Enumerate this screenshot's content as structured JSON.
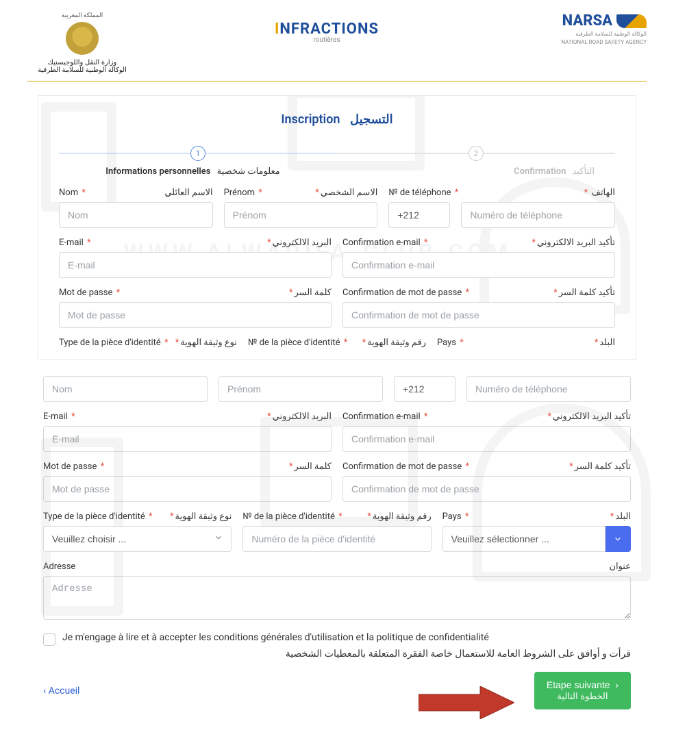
{
  "header": {
    "kingdom_ar": "المملكة المغربية",
    "ministry_ar": "وزارة النقل واللوجيستيك",
    "agency_ar": "الوكالة الوطنية للسلامة الطرقية",
    "center_brand_pre": "I",
    "center_brand_main": "NFRACTIONS",
    "center_sub": "routières",
    "narsa": "NARSA",
    "narsa_sub1": "الوكالة الوطنية للسلامة الطرقية",
    "narsa_sub2": "NATIONAL ROAD SAFETY AGENCY"
  },
  "title": {
    "fr": "Inscription",
    "ar": "التسجيل"
  },
  "steps": {
    "s1_num": "1",
    "s2_num": "2",
    "s1_fr": "Informations personnelles",
    "s1_ar": "معلومات شخصية",
    "s2_fr": "Confirmation",
    "s2_ar": "التأكيد"
  },
  "labels": {
    "nom_fr": "Nom",
    "nom_ar": "الاسم العائلي",
    "prenom_fr": "Prénom",
    "prenom_ar": "الاسم الشخصي",
    "tel_fr": "№ de téléphone",
    "tel_ar": "الهاتف",
    "email_fr": "E-mail",
    "email_ar": "البريد الالكتروني",
    "cemail_fr": "Confirmation e-mail",
    "cemail_ar": "تأكيد البريد الالكتروني",
    "pass_fr": "Mot de passe",
    "pass_ar": "كلمة السر",
    "cpass_fr": "Confirmation de mot de passe",
    "cpass_ar": "تأكيد كلمة السر",
    "idtype_fr": "Type de la pièce d'identité",
    "idtype_ar": "نوع وثيقة الهوية",
    "idnum_fr": "№ de la pièce d'identité",
    "idnum_ar": "رقم وثيقة الهوية",
    "pays_fr": "Pays",
    "pays_ar": "البلد",
    "adresse_fr": "Adresse",
    "adresse_ar": "عنوان"
  },
  "placeholders": {
    "nom": "Nom",
    "prenom": "Prénom",
    "code": "+212",
    "tel": "Numéro de téléphone",
    "email": "E-mail",
    "cemail": "Confirmation e-mail",
    "pass": "Mot de passe",
    "cpass": "Confirmation de mot de passe",
    "idtype": "Veuillez choisir ...",
    "idnum": "Numéro de la pièce d'identité",
    "pays": "Veuillez sélectionner ...",
    "adresse": "Adresse"
  },
  "consent": {
    "fr": "Je m'engage à lire et à accepter les conditions générales d'utilisation et la politique de confidentialité",
    "ar": "قرأت و أوافق على الشروط العامة للاستعمال خاصة الفقرة المتعلقة بالمعطيات الشخصية"
  },
  "footer": {
    "home": "Accueil",
    "next_fr": "Etape suivante",
    "next_ar": "الخطوة التالية"
  },
  "watermark_url": "WWW.ALWADIFA-CLUB.COM"
}
